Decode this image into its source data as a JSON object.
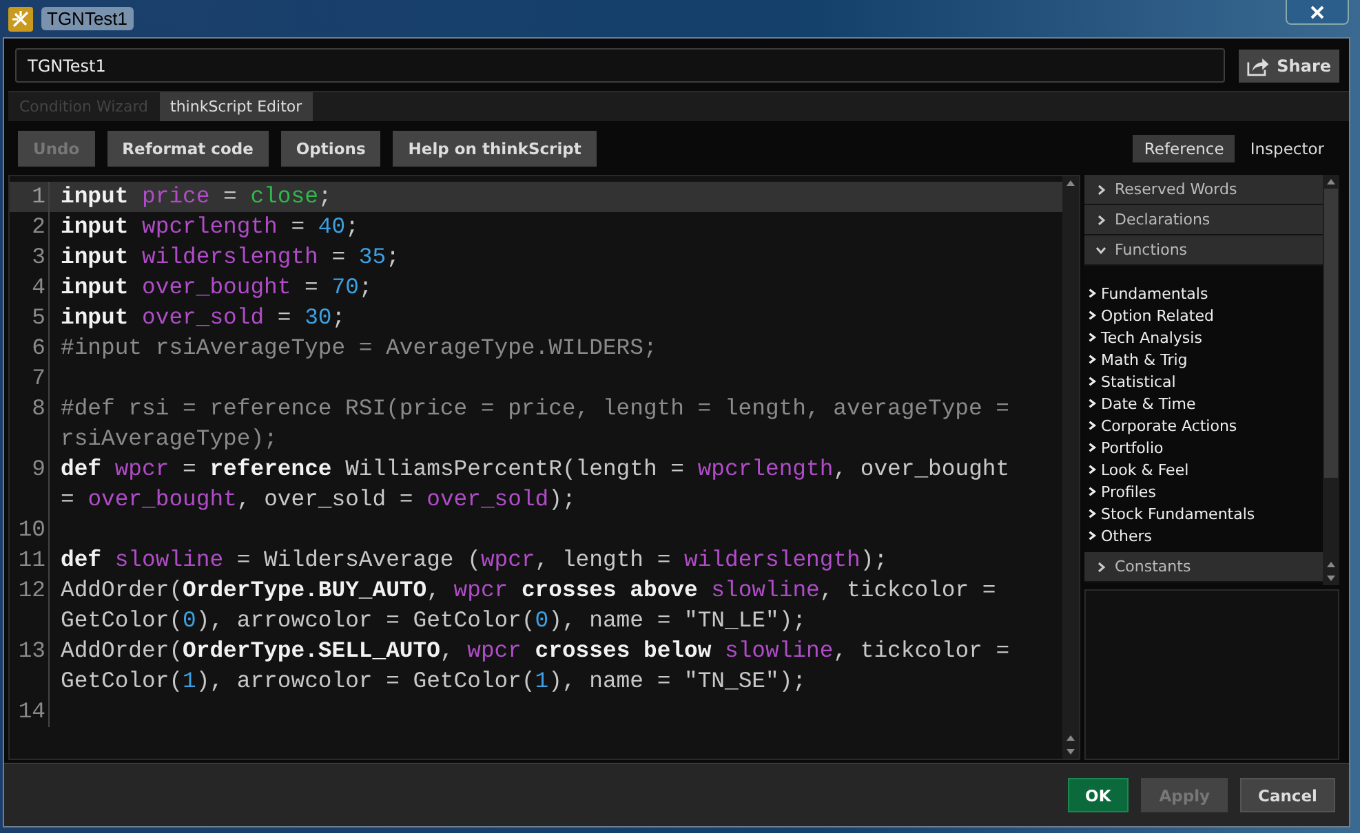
{
  "window": {
    "title": "TGNTest1"
  },
  "name_field": {
    "value": "TGNTest1"
  },
  "share_button": {
    "label": "Share"
  },
  "tabs": [
    {
      "label": "Condition Wizard",
      "selected": false
    },
    {
      "label": "thinkScript Editor",
      "selected": true
    }
  ],
  "toolbar": [
    {
      "label": "Undo",
      "disabled": true
    },
    {
      "label": "Reformat code",
      "disabled": false
    },
    {
      "label": "Options",
      "disabled": false
    },
    {
      "label": "Help on thinkScript",
      "disabled": false
    }
  ],
  "side_tabs": [
    {
      "label": "Reference",
      "selected": true
    },
    {
      "label": "Inspector",
      "selected": false
    }
  ],
  "code_lines": [
    {
      "number": "1",
      "current": true,
      "tokens": [
        {
          "kind": "keyword",
          "text": "input"
        },
        {
          "kind": "var",
          "text": "price",
          "gap": true
        },
        {
          "kind": "plain",
          "text": " = "
        },
        {
          "kind": "const",
          "text": "close"
        },
        {
          "kind": "plain",
          "text": ";"
        }
      ]
    },
    {
      "number": "2",
      "current": false,
      "tokens": [
        {
          "kind": "keyword",
          "text": "input"
        },
        {
          "kind": "var",
          "text": "wpcrlength",
          "gap": true
        },
        {
          "kind": "plain",
          "text": " = "
        },
        {
          "kind": "num",
          "text": "40"
        },
        {
          "kind": "plain",
          "text": ";"
        }
      ]
    },
    {
      "number": "3",
      "current": false,
      "tokens": [
        {
          "kind": "keyword",
          "text": "input"
        },
        {
          "kind": "var",
          "text": "wilderslength",
          "gap": true
        },
        {
          "kind": "plain",
          "text": " = "
        },
        {
          "kind": "num",
          "text": "35"
        },
        {
          "kind": "plain",
          "text": ";"
        }
      ]
    },
    {
      "number": "4",
      "current": false,
      "tokens": [
        {
          "kind": "keyword",
          "text": "input"
        },
        {
          "kind": "var",
          "text": "over_bought",
          "gap": true
        },
        {
          "kind": "plain",
          "text": " = "
        },
        {
          "kind": "num",
          "text": "70"
        },
        {
          "kind": "plain",
          "text": ";"
        }
      ]
    },
    {
      "number": "5",
      "current": false,
      "tokens": [
        {
          "kind": "keyword",
          "text": "input"
        },
        {
          "kind": "var",
          "text": "over_sold",
          "gap": true
        },
        {
          "kind": "plain",
          "text": " = "
        },
        {
          "kind": "num",
          "text": "30"
        },
        {
          "kind": "plain",
          "text": ";"
        }
      ]
    },
    {
      "number": "6",
      "current": false,
      "tokens": [
        {
          "kind": "comment",
          "text": "#input rsiAverageType = AverageType.WILDERS;"
        }
      ]
    },
    {
      "number": "7",
      "current": false
    },
    {
      "number": "8",
      "current": false,
      "tokens": [
        {
          "kind": "comment",
          "text": "#def rsi = reference RSI(price = price, length = length, averageType ="
        },
        {
          "kind": "wrap"
        },
        {
          "kind": "comment",
          "text": "rsiAverageType);"
        }
      ]
    },
    {
      "number": "9",
      "current": false,
      "tokens": [
        {
          "kind": "keyword",
          "text": "def"
        },
        {
          "kind": "var",
          "text": "wpcr",
          "gap": true
        },
        {
          "kind": "plain",
          "text": " = "
        },
        {
          "kind": "keyword",
          "text": "reference"
        },
        {
          "kind": "plain",
          "text": " WilliamsPercentR(length = "
        },
        {
          "kind": "var",
          "text": "wpcrlength"
        },
        {
          "kind": "plain",
          "text": ", over_bought"
        },
        {
          "kind": "wrap"
        },
        {
          "kind": "plain",
          "text": "= "
        },
        {
          "kind": "var",
          "text": "over_bought"
        },
        {
          "kind": "plain",
          "text": ", over_sold = "
        },
        {
          "kind": "var",
          "text": "over_sold"
        },
        {
          "kind": "plain",
          "text": ");"
        }
      ]
    },
    {
      "number": "10",
      "current": false
    },
    {
      "number": "11",
      "current": false,
      "tokens": [
        {
          "kind": "keyword",
          "text": "def"
        },
        {
          "kind": "var",
          "text": "slowline",
          "gap": true
        },
        {
          "kind": "plain",
          "text": " = WildersAverage ("
        },
        {
          "kind": "var",
          "text": "wpcr"
        },
        {
          "kind": "plain",
          "text": ", length = "
        },
        {
          "kind": "var",
          "text": "wilderslength"
        },
        {
          "kind": "plain",
          "text": ");"
        }
      ]
    },
    {
      "number": "12",
      "current": false,
      "tokens": [
        {
          "kind": "plain",
          "text": "AddOrder("
        },
        {
          "kind": "keyword",
          "text": "OrderType.BUY_AUTO"
        },
        {
          "kind": "plain",
          "text": ", "
        },
        {
          "kind": "var",
          "text": "wpcr"
        },
        {
          "kind": "keyword",
          "text": "crosses above",
          "gap": true
        },
        {
          "kind": "var",
          "text": "slowline",
          "gap": true
        },
        {
          "kind": "plain",
          "text": ", tickcolor ="
        },
        {
          "kind": "wrap"
        },
        {
          "kind": "plain",
          "text": "GetColor("
        },
        {
          "kind": "num",
          "text": "0"
        },
        {
          "kind": "plain",
          "text": "), arrowcolor = GetColor("
        },
        {
          "kind": "num",
          "text": "0"
        },
        {
          "kind": "plain",
          "text": "), name = \"TN_LE\");"
        }
      ]
    },
    {
      "number": "13",
      "current": false,
      "tokens": [
        {
          "kind": "plain",
          "text": "AddOrder("
        },
        {
          "kind": "keyword",
          "text": "OrderType.SELL_AUTO"
        },
        {
          "kind": "plain",
          "text": ", "
        },
        {
          "kind": "var",
          "text": "wpcr"
        },
        {
          "kind": "keyword",
          "text": "crosses below",
          "gap": true
        },
        {
          "kind": "var",
          "text": "slowline",
          "gap": true
        },
        {
          "kind": "plain",
          "text": ", tickcolor ="
        },
        {
          "kind": "wrap"
        },
        {
          "kind": "plain",
          "text": "GetColor("
        },
        {
          "kind": "num",
          "text": "1"
        },
        {
          "kind": "plain",
          "text": "), arrowcolor = GetColor("
        },
        {
          "kind": "num",
          "text": "1"
        },
        {
          "kind": "plain",
          "text": "), name = \"TN_SE\");"
        }
      ]
    },
    {
      "number": "14",
      "current": false
    }
  ],
  "reference": [
    {
      "label": "Reserved Words",
      "expanded": false
    },
    {
      "label": "Declarations",
      "expanded": false
    },
    {
      "label": "Functions",
      "expanded": true,
      "children": [
        {
          "label": "Fundamentals"
        },
        {
          "label": "Option Related"
        },
        {
          "label": "Tech Analysis"
        },
        {
          "label": "Math & Trig"
        },
        {
          "label": "Statistical"
        },
        {
          "label": "Date & Time"
        },
        {
          "label": "Corporate Actions"
        },
        {
          "label": "Portfolio"
        },
        {
          "label": "Look & Feel"
        },
        {
          "label": "Profiles"
        },
        {
          "label": "Stock Fundamentals"
        },
        {
          "label": "Others"
        }
      ]
    },
    {
      "label": "Constants",
      "expanded": false
    }
  ],
  "footer_buttons": [
    {
      "label": "OK",
      "kind": "primary",
      "disabled": false
    },
    {
      "label": "Apply",
      "kind": "normal",
      "disabled": true
    },
    {
      "label": "Cancel",
      "kind": "normal",
      "disabled": false
    }
  ]
}
